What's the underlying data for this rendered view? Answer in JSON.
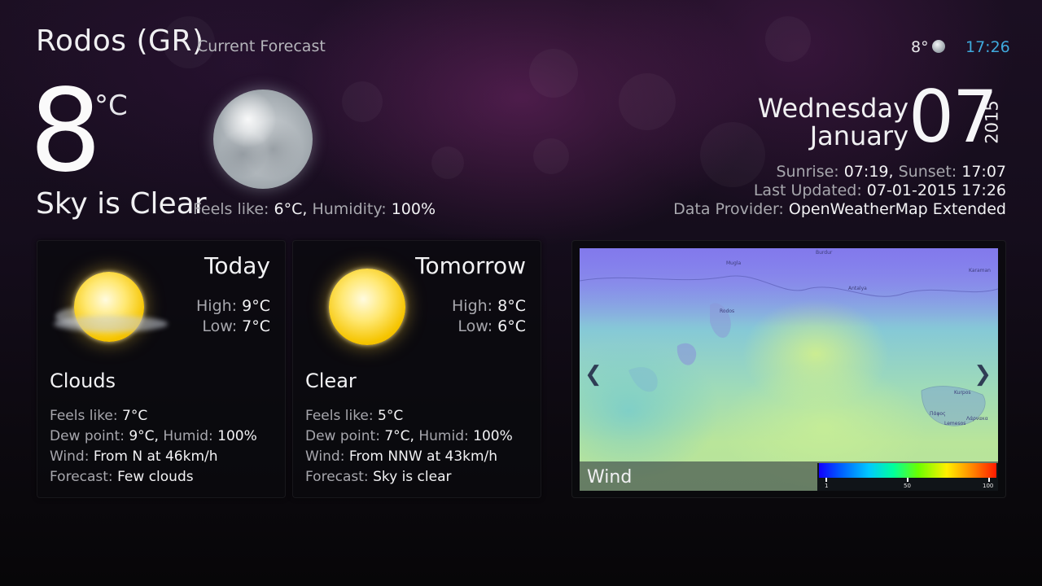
{
  "header": {
    "city": "Rodos (GR)",
    "subtitle": "Current Forecast",
    "temp": "8°",
    "time": "17:26"
  },
  "current": {
    "temp": "8",
    "unit": "°C",
    "condition": "Sky is Clear",
    "feels_label": "Feels like:",
    "feels_value": "6°C,",
    "humidity_label": "Humidity:",
    "humidity_value": "100%",
    "icon": "moon-icon"
  },
  "date": {
    "weekday": "Wednesday",
    "month": "January",
    "day": "07",
    "year": "2015"
  },
  "info": {
    "sunrise_label": "Sunrise:",
    "sunrise_value": "07:19,",
    "sunset_label": "Sunset:",
    "sunset_value": "17:07",
    "updated_label": "Last Updated:",
    "updated_value": "07-01-2015 17:26",
    "provider_label": "Data Provider:",
    "provider_value": "OpenWeatherMap Extended"
  },
  "cards": [
    {
      "title": "Today",
      "high_label": "High:",
      "high_value": "9°C",
      "low_label": "Low:",
      "low_value": "7°C",
      "condition": "Clouds",
      "feels_label": "Feels like:",
      "feels_value": "7°C",
      "dew_label": "Dew point:",
      "dew_value": "9°C,",
      "humid_label": "Humid:",
      "humid_value": "100%",
      "wind_label": "Wind:",
      "wind_value": "From N at 46km/h",
      "forecast_label": "Forecast:",
      "forecast_value": "Few clouds",
      "icon": "partly-cloudy-sun-icon"
    },
    {
      "title": "Tomorrow",
      "high_label": "High:",
      "high_value": "8°C",
      "low_label": "Low:",
      "low_value": "6°C",
      "condition": "Clear",
      "feels_label": "Feels like:",
      "feels_value": "5°C",
      "dew_label": "Dew point:",
      "dew_value": "7°C,",
      "humid_label": "Humid:",
      "humid_value": "100%",
      "wind_label": "Wind:",
      "wind_value": "From NNW at 43km/h",
      "forecast_label": "Forecast:",
      "forecast_value": "Sky is clear",
      "icon": "sun-icon"
    }
  ],
  "map": {
    "layer_label": "Wind",
    "scale_min": "1",
    "scale_mid": "50",
    "scale_max": "100",
    "labels": [
      "Mugla",
      "Burdur",
      "Karaman",
      "Antalya",
      "Rodos",
      "Λάρνακα",
      "Lemesos",
      "Kurpos",
      "Πάφος"
    ],
    "prev_icon": "chevron-left-icon",
    "next_icon": "chevron-right-icon"
  }
}
